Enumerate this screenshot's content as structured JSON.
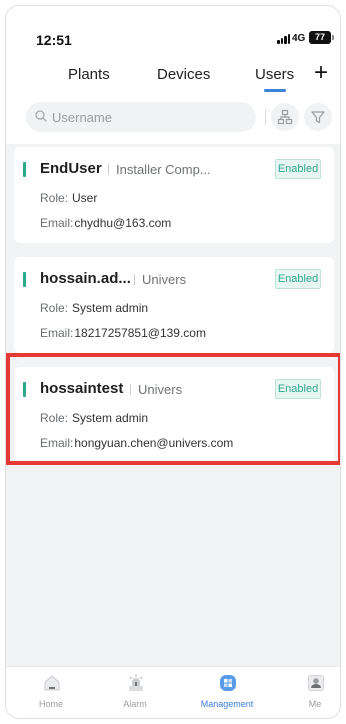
{
  "status_bar": {
    "time": "12:51",
    "network": "4G",
    "battery": "77"
  },
  "tabs": [
    {
      "label": "Plants",
      "active": false
    },
    {
      "label": "Devices",
      "active": false
    },
    {
      "label": "Users",
      "active": true
    }
  ],
  "add_button": {
    "label": "+"
  },
  "search": {
    "placeholder": "Username",
    "value": ""
  },
  "colors": {
    "accent": "#3b82d8",
    "status_green": "#2ea78f",
    "highlight_red": "#e53935"
  },
  "users": [
    {
      "name": "EndUser",
      "company": "Installer Comp...",
      "status": "Enabled",
      "role_label": "Role:",
      "role": "User",
      "email_label": "Email:",
      "email": "chydhu@163.com"
    },
    {
      "name": "hossain.ad...",
      "company": "Univers",
      "status": "Enabled",
      "role_label": "Role:",
      "role": "System admin",
      "email_label": "Email:",
      "email": "18217257851@139.com"
    },
    {
      "name": "hossaintest",
      "company": "Univers",
      "status": "Enabled",
      "role_label": "Role:",
      "role": "System admin",
      "email_label": "Email:",
      "email": "hongyuan.chen@univers.com"
    }
  ],
  "bottom_nav": [
    {
      "label": "Home",
      "icon": "home-icon",
      "active": false
    },
    {
      "label": "Alarm",
      "icon": "alarm-icon",
      "active": false
    },
    {
      "label": "Management",
      "icon": "management-icon",
      "active": true
    },
    {
      "label": "Me",
      "icon": "profile-icon",
      "active": false
    }
  ]
}
